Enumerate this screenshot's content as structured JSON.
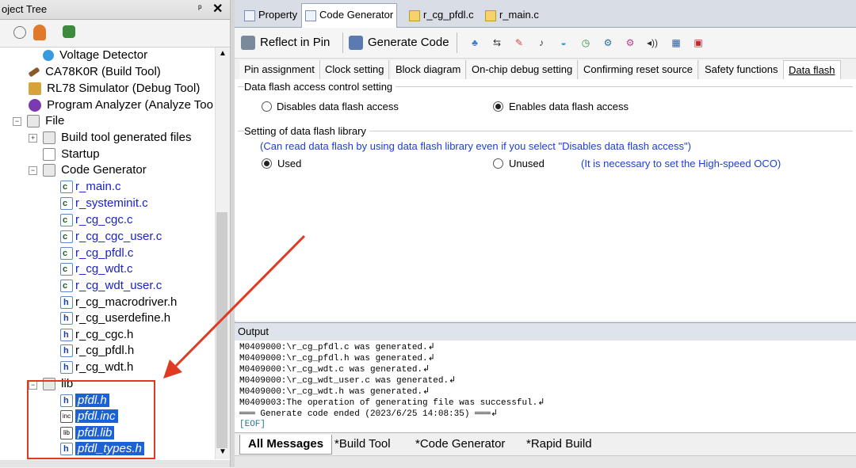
{
  "left_panel": {
    "title": "oject Tree",
    "pin_glyph": "ᵖ",
    "close_glyph": "✕",
    "tree": {
      "voltage_detector": "Voltage Detector",
      "build_tool": "CA78K0R (Build Tool)",
      "debug_tool": "RL78 Simulator (Debug Tool)",
      "program_analyzer": "Program Analyzer (Analyze Tool",
      "file": "File",
      "build_generated": "Build tool generated files",
      "startup": "Startup",
      "code_generator": "Code Generator",
      "files": [
        "r_main.c",
        "r_systeminit.c",
        "r_cg_cgc.c",
        "r_cg_cgc_user.c",
        "r_cg_pfdl.c",
        "r_cg_wdt.c",
        "r_cg_wdt_user.c",
        "r_cg_macrodriver.h",
        "r_cg_userdefine.h",
        "r_cg_cgc.h",
        "r_cg_pfdl.h",
        "r_cg_wdt.h"
      ],
      "lib": "lib",
      "lib_files": [
        "pfdl.h",
        "pfdl.inc",
        "pfdl.lib",
        "pfdl_types.h"
      ],
      "lib_icons": [
        "h",
        "inc",
        "lib",
        "h"
      ]
    }
  },
  "doc_tabs": [
    "Property",
    "Code Generator",
    "r_cg_pfdl.c",
    "r_main.c"
  ],
  "toolbar": {
    "reflect_label": "Reflect in Pin",
    "generate_label": "Generate Code"
  },
  "subtabs": [
    "Pin assignment",
    "Clock setting",
    "Block diagram",
    "On-chip debug setting",
    "Confirming reset source",
    "Safety functions",
    "Data flash"
  ],
  "settings": {
    "access_group": "Data flash access control setting",
    "disable_label": "Disables data flash access",
    "enable_label": "Enables data flash access",
    "library_group": "Setting of data flash library",
    "library_note": "(Can read data flash by using data flash library even if you select \"Disables data flash access\")",
    "used_label": "Used",
    "unused_label": "Unused",
    "hoco_note": "(It is necessary to set the High-speed OCO)"
  },
  "output": {
    "title": "Output",
    "lines": [
      "M0409000:\\r_cg_pfdl.c was generated.↲",
      "M0409000:\\r_cg_pfdl.h was generated.↲",
      "M0409000:\\r_cg_wdt.c was generated.↲",
      "M0409000:\\r_cg_wdt_user.c was generated.↲",
      "M0409000:\\r_cg_wdt.h was generated.↲",
      "M0409003:The operation of generating file was successful.↲",
      "═══ Generate code ended (2023/6/25 14:08:35) ═══↲"
    ],
    "eof": "[EOF]"
  },
  "output_tabs": [
    "All Messages",
    "*Build Tool",
    "*Code Generator",
    "*Rapid Build"
  ],
  "colors": {
    "selection": "#1c62d4",
    "link": "#1a22c8",
    "annotation_red": "#e03a22",
    "note_blue": "#1c3fd0"
  }
}
